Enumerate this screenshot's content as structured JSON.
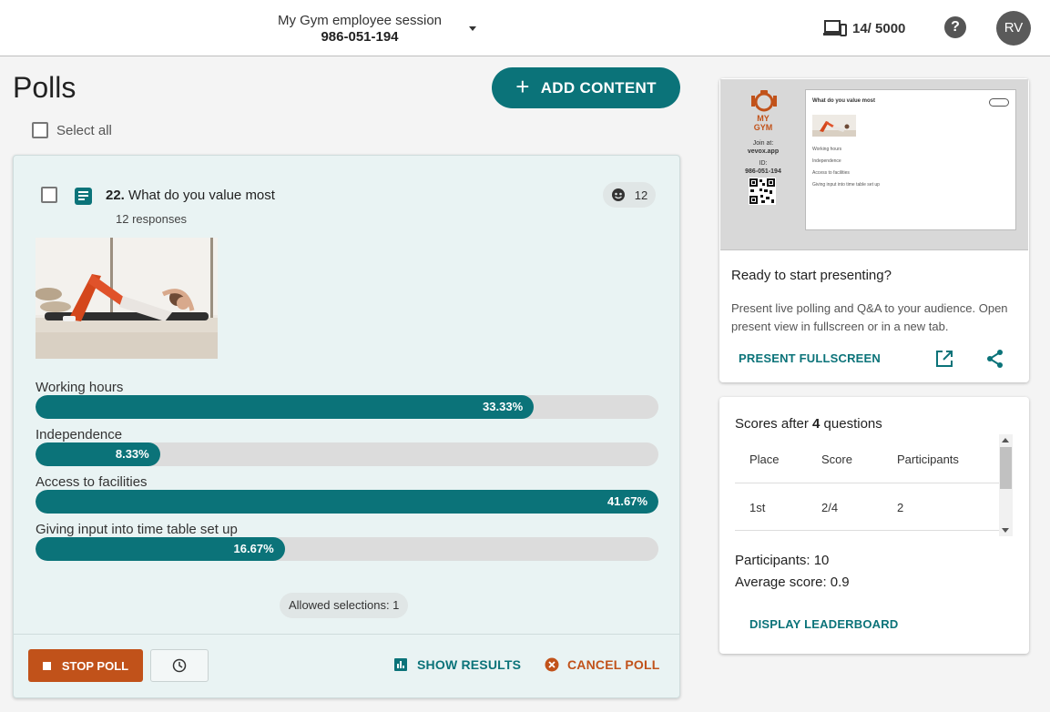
{
  "header": {
    "session_name": "My Gym employee session",
    "session_code": "986-051-194",
    "devices_count": "14/ 5000",
    "help_label": "?",
    "avatar_initials": "RV"
  },
  "page": {
    "title": "Polls",
    "add_content_label": "ADD CONTENT",
    "select_all_label": "Select all"
  },
  "poll": {
    "number": "22.",
    "question": "What do you value most",
    "responses_text": "12 responses",
    "responses_count": "12",
    "options": [
      {
        "label": "Working hours",
        "percent": 33.33,
        "percent_text": "33.33%"
      },
      {
        "label": "Independence",
        "percent": 8.33,
        "percent_text": "8.33%"
      },
      {
        "label": "Access to facilities",
        "percent": 41.67,
        "percent_text": "41.67%"
      },
      {
        "label": "Giving input into time table set up",
        "percent": 16.67,
        "percent_text": "16.67%"
      }
    ],
    "allowed_selections": "Allowed selections: 1",
    "stop_poll_label": "STOP POLL",
    "show_results_label": "SHOW RESULTS",
    "cancel_poll_label": "CANCEL POLL"
  },
  "present": {
    "preview": {
      "logo_text": "MY GYM",
      "join_at_label": "Join at:",
      "join_url": "vevox.app",
      "id_label": "ID:",
      "id_value": "986-051-194",
      "slide_title": "What do you value most",
      "slide_options": [
        "Working hours",
        "Independence",
        "Access to facilities",
        "Giving input into time table set up"
      ]
    },
    "title": "Ready to start presenting?",
    "description": "Present live polling and Q&A to your audience. Open present view in fullscreen or in a new tab.",
    "fullscreen_label": "PRESENT FULLSCREEN"
  },
  "scores": {
    "title_prefix": "Scores after ",
    "question_count": "4",
    "title_suffix": " questions",
    "columns": [
      "Place",
      "Score",
      "Participants"
    ],
    "rows": [
      {
        "place": "1st",
        "score": "2/4",
        "participants": "2"
      }
    ],
    "participants_text": "Participants: 10",
    "average_text": "Average score: 0.9",
    "leaderboard_label": "DISPLAY LEADERBOARD"
  },
  "colors": {
    "accent": "#0b7379",
    "danger": "#c1521a",
    "track": "#dcdcdc",
    "card_bg": "#e9f3f3"
  }
}
